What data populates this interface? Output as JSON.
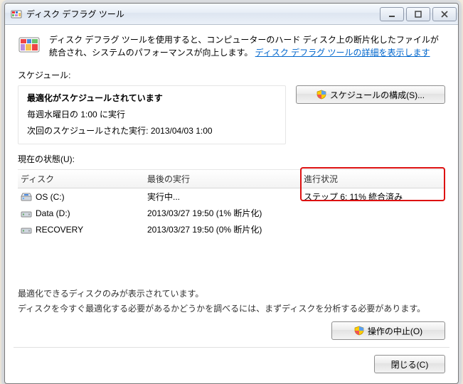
{
  "window": {
    "title": "ディスク デフラグ ツール"
  },
  "intro": {
    "text_before": "ディスク デフラグ ツールを使用すると、コンピューターのハード ディスク上の断片化したファイルが統合され、システムのパフォーマンスが向上します。",
    "link": "ディスク デフラグ ツールの詳細を表示します"
  },
  "labels": {
    "schedule": "スケジュール:",
    "status": "現在の状態(U):",
    "note1": "最適化できるディスクのみが表示されています。",
    "note2": "ディスクを今すぐ最適化する必要があるかどうかを調べるには、まずディスクを分析する必要があります。"
  },
  "schedule": {
    "heading": "最適化がスケジュールされています",
    "line1": "毎週水曜日の 1:00 に実行",
    "line2": "次回のスケジュールされた実行: 2013/04/03 1:00",
    "config_button": "スケジュールの構成(S)..."
  },
  "table": {
    "head_disk": "ディスク",
    "head_last": "最後の実行",
    "head_prog": "進行状況",
    "rows": [
      {
        "name": "OS (C:)",
        "icon": "os",
        "last": "実行中...",
        "prog": "ステップ 6: 11% 統合済み"
      },
      {
        "name": "Data (D:)",
        "icon": "hdd",
        "last": "2013/03/27 19:50 (1% 断片化)",
        "prog": ""
      },
      {
        "name": "RECOVERY",
        "icon": "hdd",
        "last": "2013/03/27 19:50 (0% 断片化)",
        "prog": ""
      }
    ]
  },
  "buttons": {
    "stop": "操作の中止(O)",
    "close": "閉じる(C)"
  }
}
